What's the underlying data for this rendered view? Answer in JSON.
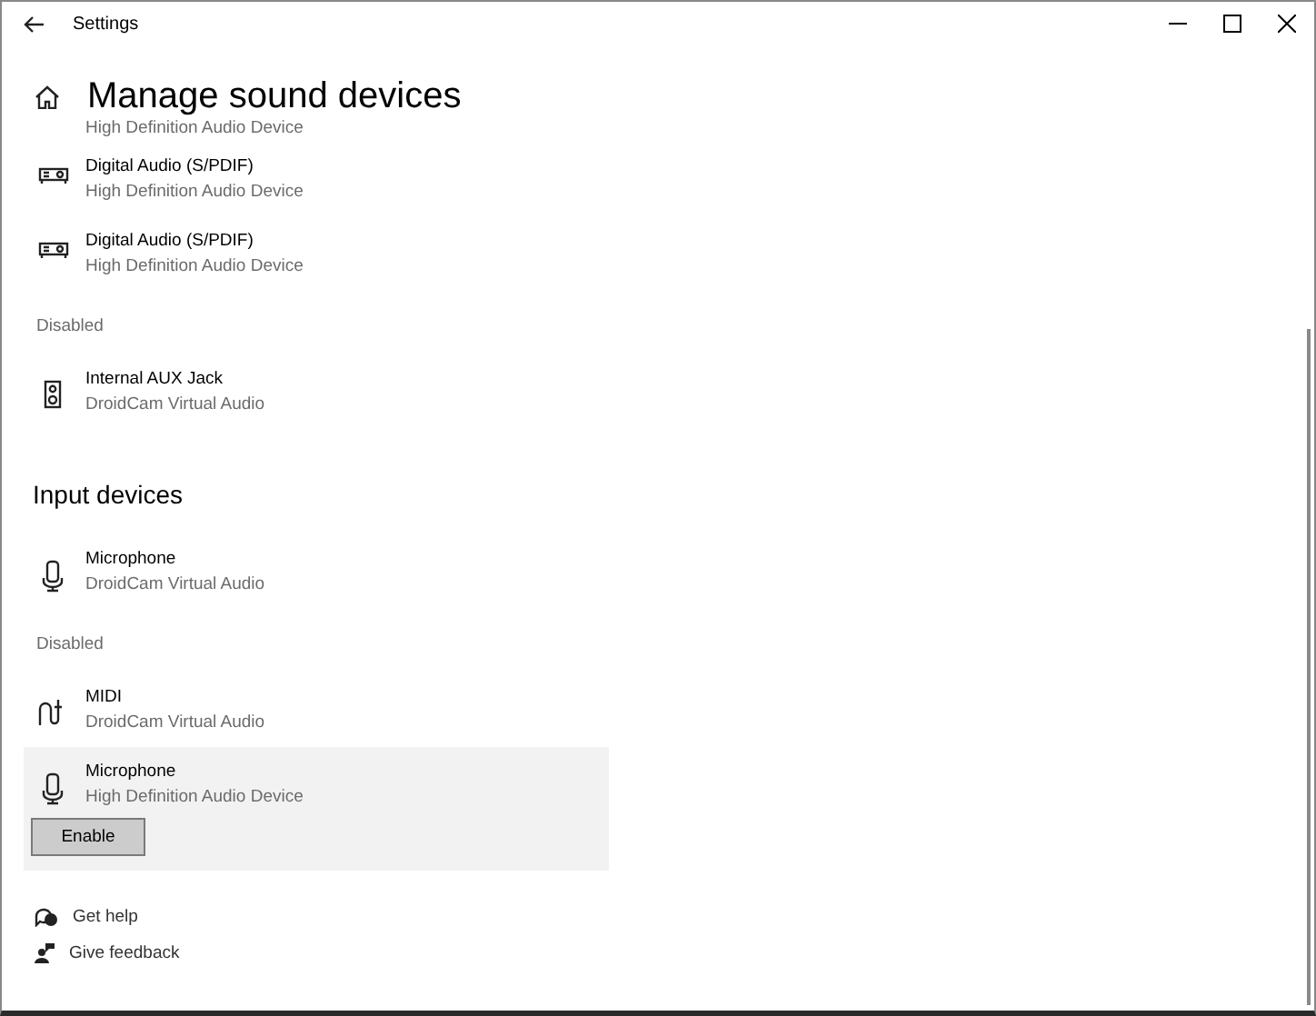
{
  "window": {
    "title": "Settings"
  },
  "page_title": "Manage sound devices",
  "scrolled_detail": "High Definition Audio Device",
  "sections": [
    {
      "kind": "list",
      "devices": [
        {
          "kind": "digital",
          "name": "Digital Audio (S/PDIF)",
          "detail": "High Definition Audio Device",
          "selected": false
        },
        {
          "kind": "digital",
          "name": "Digital Audio (S/PDIF)",
          "detail": "High Definition Audio Device",
          "selected": false
        }
      ]
    },
    {
      "kind": "sub",
      "heading": "Disabled",
      "devices": [
        {
          "kind": "speaker",
          "name": "Internal AUX Jack",
          "detail": "DroidCam Virtual Audio",
          "selected": false
        }
      ]
    },
    {
      "kind": "title",
      "heading": "Input devices",
      "devices": [
        {
          "kind": "mic",
          "name": "Microphone",
          "detail": "DroidCam Virtual Audio",
          "selected": false
        }
      ]
    },
    {
      "kind": "sub",
      "heading": "Disabled",
      "devices": [
        {
          "kind": "midi",
          "name": "MIDI",
          "detail": "DroidCam Virtual Audio",
          "selected": false
        },
        {
          "kind": "mic",
          "name": "Microphone",
          "detail": "High Definition Audio Device",
          "selected": true,
          "action": "Enable"
        }
      ]
    }
  ],
  "links": [
    {
      "label": "Get help"
    },
    {
      "label": "Give feedback"
    }
  ]
}
